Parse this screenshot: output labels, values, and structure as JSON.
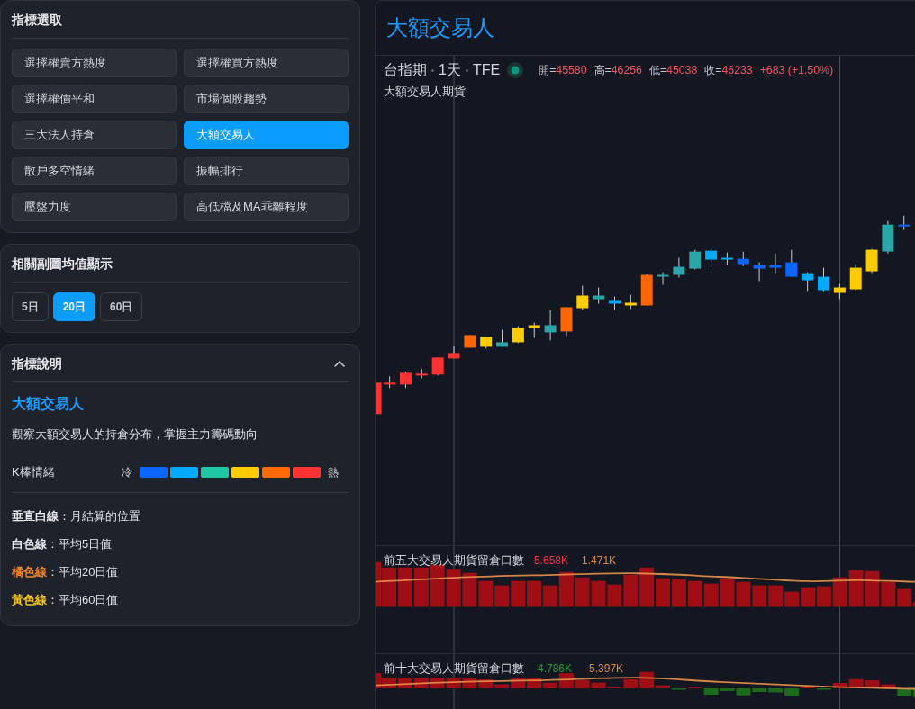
{
  "indicator_panel": {
    "title": "指標選取",
    "options": [
      {
        "label": "選擇權賣方熱度",
        "selected": false
      },
      {
        "label": "選擇權買方熱度",
        "selected": false
      },
      {
        "label": "選擇權價平和",
        "selected": false
      },
      {
        "label": "市場個股趨勢",
        "selected": false
      },
      {
        "label": "三大法人持倉",
        "selected": false
      },
      {
        "label": "大額交易人",
        "selected": true
      },
      {
        "label": "散戶多空情緒",
        "selected": false
      },
      {
        "label": "振幅排行",
        "selected": false
      },
      {
        "label": "壓盤力度",
        "selected": false
      },
      {
        "label": "高低檔及MA乖離程度",
        "selected": false
      }
    ]
  },
  "average_panel": {
    "title": "相關副圖均值顯示",
    "options": [
      {
        "label": "5日",
        "selected": false
      },
      {
        "label": "20日",
        "selected": true
      },
      {
        "label": "60日",
        "selected": false
      }
    ]
  },
  "description_panel": {
    "title": "指標說明",
    "expanded": true,
    "heading": "大額交易人",
    "text": "觀察大額交易人的持倉分布，掌握主力籌碼動向",
    "sentiment_scale": {
      "label": "K棒情緒",
      "low": "冷",
      "high": "熱",
      "swatches": [
        {
          "color": "#0a66ff"
        },
        {
          "color": "#00aaff"
        },
        {
          "color": "#1fc7a3"
        },
        {
          "color": "#ffcc00"
        },
        {
          "color": "#ff6a00"
        },
        {
          "color": "#ff3333"
        }
      ]
    },
    "legend": [
      {
        "term": "垂直白線",
        "text": "：月結算的位置",
        "color": "#e6e8eb"
      },
      {
        "term": "白色線",
        "text": "：平均5日值",
        "color": "#e6e8eb"
      },
      {
        "term": "橘色線",
        "text": "：平均20日值",
        "color": "#f0862a"
      },
      {
        "term": "黃色線",
        "text": "：平均60日值",
        "color": "#f5c518"
      }
    ]
  },
  "chart_panel": {
    "title": "大額交易人",
    "symbol": "台指期",
    "interval": "1天",
    "exchange": "TFE",
    "ohlc": [
      {
        "label": "開=",
        "value": "45580"
      },
      {
        "label": "高=",
        "value": "46256"
      },
      {
        "label": "低=",
        "value": "45038"
      },
      {
        "label": "收=",
        "value": "46233"
      }
    ],
    "change": "+683 (+1.50%)",
    "series_name": "大額交易人期貨",
    "subcharts": [
      {
        "title": "前五大交易人期貨留倉口數",
        "values": [
          {
            "text": "5.658K",
            "color": "#f23645"
          },
          {
            "text": "1.471K",
            "color": "#e0883c"
          }
        ]
      },
      {
        "title": "前十大交易人期貨留倉口數",
        "values": [
          {
            "text": "-4.786K",
            "color": "#2a9d2a"
          },
          {
            "text": "-5.397K",
            "color": "#e0883c"
          }
        ]
      }
    ]
  }
}
